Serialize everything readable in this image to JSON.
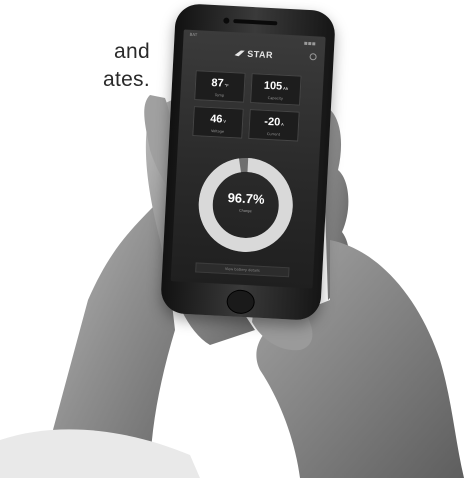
{
  "background_text": {
    "line1": "and",
    "line2": "ates."
  },
  "status_bar": {
    "carrier": "BAT"
  },
  "app": {
    "logo_text": "STAR",
    "icons": {
      "settings": "gear-icon",
      "logo": "star-logo-icon"
    },
    "tiles": [
      {
        "value": "87",
        "unit": "°F",
        "label": "Temp"
      },
      {
        "value": "105",
        "unit": "Ah",
        "label": "Capacity"
      },
      {
        "value": "46",
        "unit": "V",
        "label": "Voltage"
      },
      {
        "value": "-20",
        "unit": "A",
        "label": "Current"
      }
    ],
    "gauge": {
      "value": "96.7%",
      "label": "Charge",
      "fraction": 0.967
    },
    "details_button_label": "View battery details"
  },
  "colors": {
    "screen_bg": "#2b2b2b",
    "gauge_track": "#6f6f6f",
    "gauge_fill": "#d9d9d9",
    "tile_bg": "#1d1d1d"
  }
}
